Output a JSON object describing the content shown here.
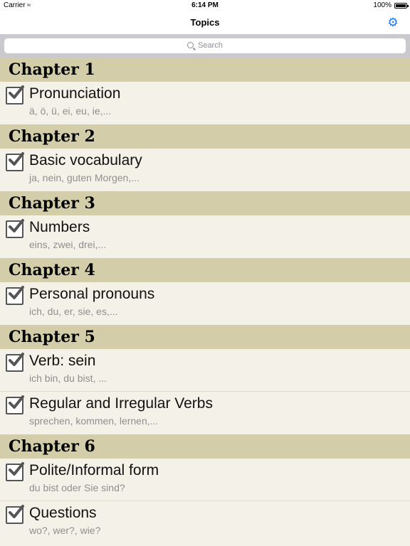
{
  "status": {
    "carrier": "Carrier",
    "time": "6:14 PM",
    "battery": "100%"
  },
  "nav": {
    "title": "Topics",
    "settings_icon": "gear-icon",
    "accent": "#1a7cf5"
  },
  "search": {
    "placeholder": "Search"
  },
  "colors": {
    "chapter_bg": "#d3cda9",
    "row_bg": "#f4f1e8"
  },
  "chapters": [
    {
      "title": "Chapter 1",
      "topics": [
        {
          "title": "Pronunciation",
          "subtitle": "ä, ö, ü, ei, eu, ie,...",
          "checked": true
        }
      ]
    },
    {
      "title": "Chapter 2",
      "topics": [
        {
          "title": "Basic vocabulary",
          "subtitle": "ja, nein, guten Morgen,...",
          "checked": true
        }
      ]
    },
    {
      "title": "Chapter 3",
      "topics": [
        {
          "title": "Numbers",
          "subtitle": "eins, zwei, drei,...",
          "checked": true
        }
      ]
    },
    {
      "title": "Chapter 4",
      "topics": [
        {
          "title": "Personal pronouns",
          "subtitle": "ich, du, er, sie, es,...",
          "checked": true
        }
      ]
    },
    {
      "title": "Chapter 5",
      "topics": [
        {
          "title": "Verb: sein",
          "subtitle": "ich bin, du bist, ...",
          "checked": true
        },
        {
          "title": "Regular and Irregular Verbs",
          "subtitle": "sprechen, kommen, lernen,...",
          "checked": true
        }
      ]
    },
    {
      "title": "Chapter 6",
      "topics": [
        {
          "title": "Polite/Informal form",
          "subtitle": "du bist oder Sie sind?",
          "checked": true
        },
        {
          "title": "Questions",
          "subtitle": "wo?, wer?, wie?",
          "checked": true
        }
      ]
    }
  ]
}
